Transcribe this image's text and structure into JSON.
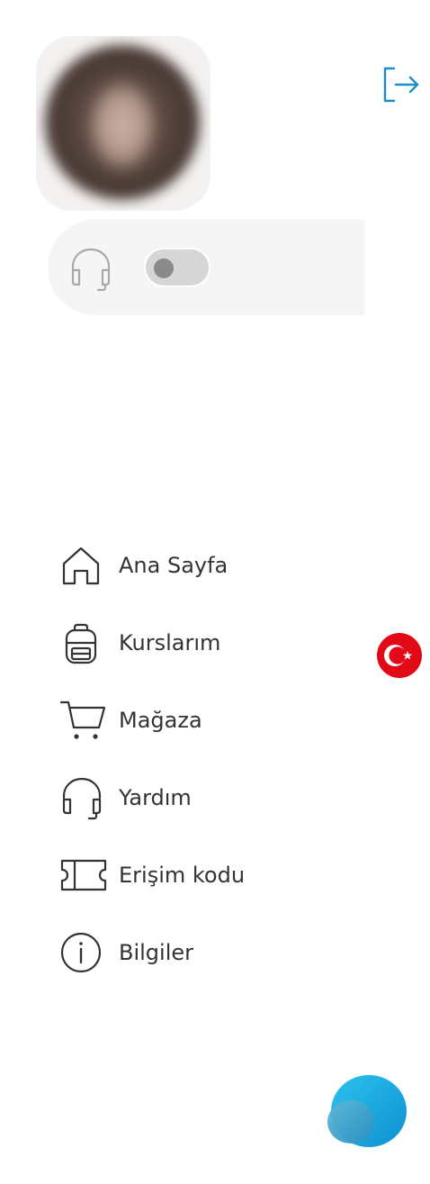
{
  "profile": {
    "avatar_alt": "Profile photo"
  },
  "header": {
    "logout_icon": "logout-icon"
  },
  "audio_toggle": {
    "icon": "headset-icon",
    "enabled": false
  },
  "menu": {
    "items": [
      {
        "label": "Ana Sayfa",
        "icon": "home-icon"
      },
      {
        "label": "Kurslarım",
        "icon": "backpack-icon"
      },
      {
        "label": "Mağaza",
        "icon": "cart-icon"
      },
      {
        "label": "Yardım",
        "icon": "headset-icon"
      },
      {
        "label": "Erişim kodu",
        "icon": "ticket-icon"
      },
      {
        "label": "Bilgiler",
        "icon": "info-icon"
      }
    ]
  },
  "language": {
    "flag_icon": "turkey-flag-icon"
  },
  "fab": {
    "icon": "chat-bubbles-icon"
  },
  "colors": {
    "accent": "#1a8fc9",
    "text": "#333333",
    "panel_bg": "#f5f5f5",
    "flag_red": "#e30a17",
    "toggle_off": "#d6d6d6"
  }
}
